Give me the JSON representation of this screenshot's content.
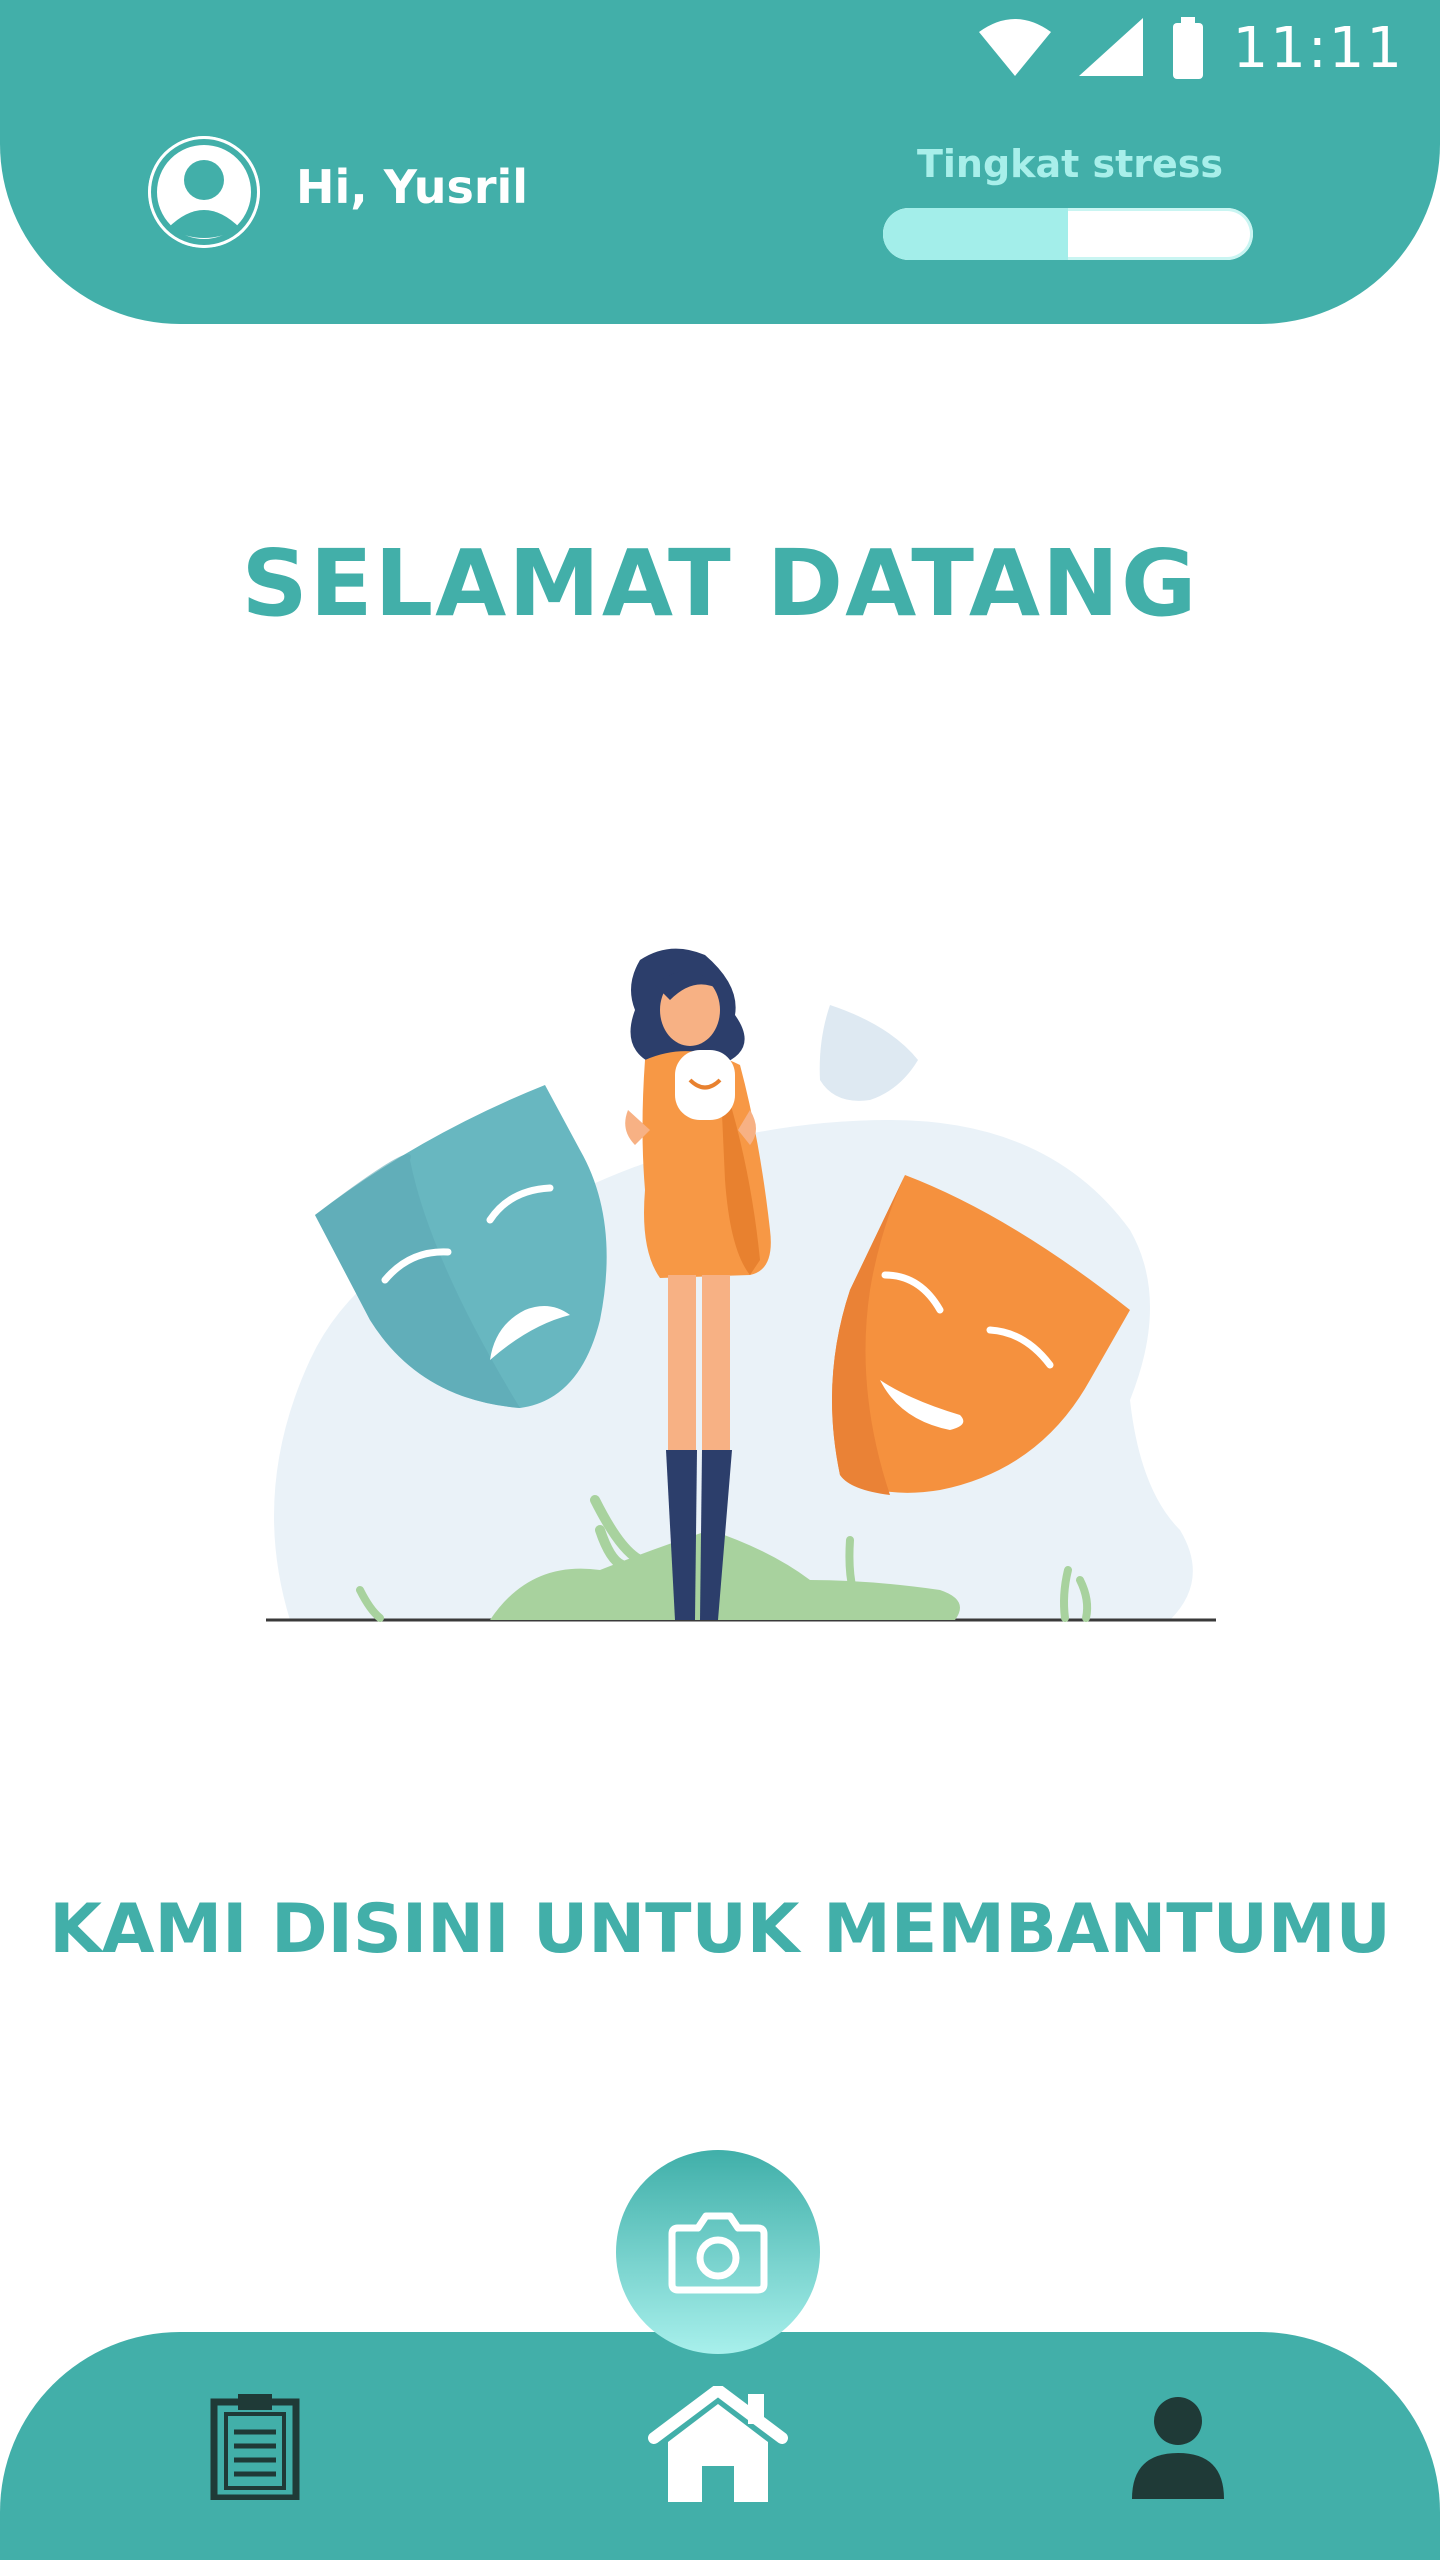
{
  "status_bar": {
    "time": "11:11"
  },
  "header": {
    "greeting": "Hi, Yusril",
    "stress_label": "Tingkat stress",
    "stress_level_percent": 50
  },
  "main": {
    "title": "SELAMAT DATANG",
    "tagline": "KAMI DISINI UNTUK MEMBANTUMU"
  },
  "bottom_nav": {
    "items": [
      {
        "icon": "clipboard-icon"
      },
      {
        "icon": "home-icon"
      },
      {
        "icon": "profile-icon"
      }
    ],
    "fab_icon": "camera-icon"
  },
  "colors": {
    "primary": "#42AFA9",
    "accent_light": "#A3EEEA",
    "dark_icon": "#1F3A37",
    "orange": "#F5913E"
  }
}
